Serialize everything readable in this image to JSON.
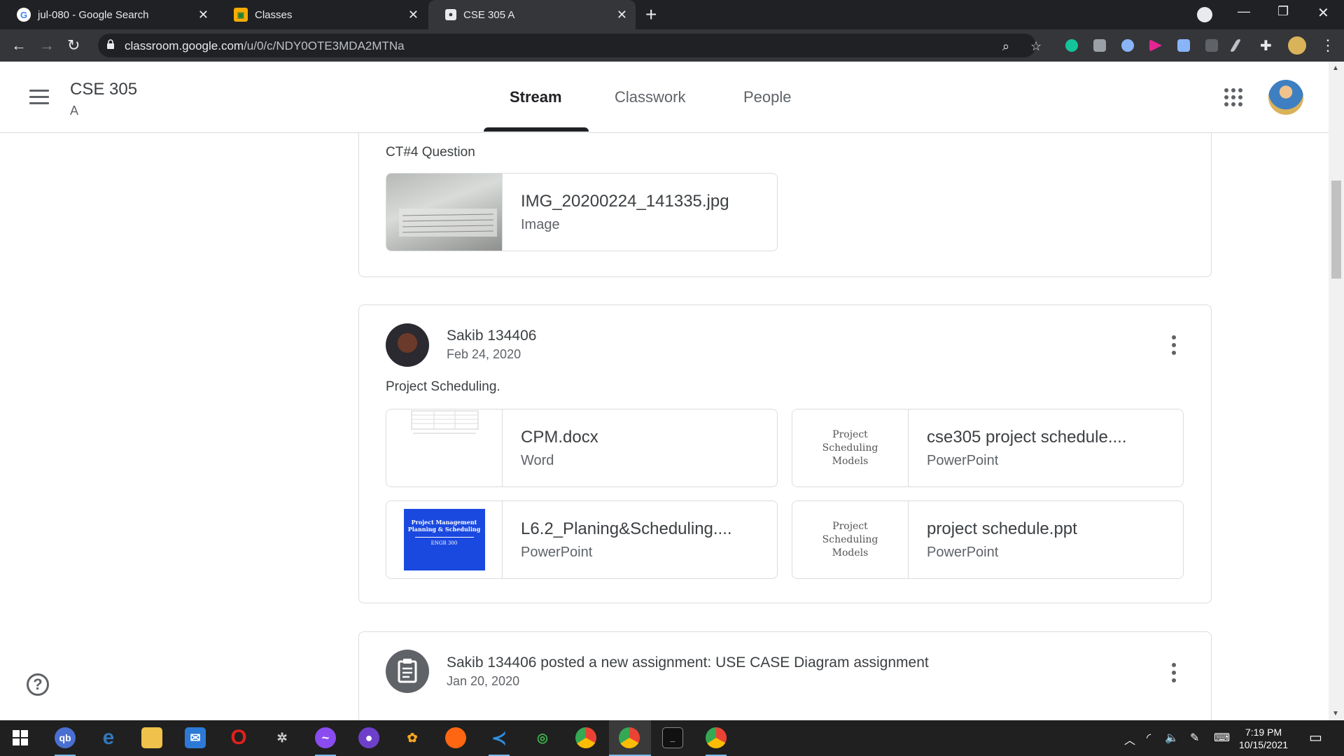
{
  "browser": {
    "tabs": [
      {
        "title": "jul-080 - Google Search",
        "favicon": "google-g-icon",
        "active": false
      },
      {
        "title": "Classes",
        "favicon": "classroom-icon",
        "active": false
      },
      {
        "title": "CSE 305 A",
        "favicon": "classroom-people-icon",
        "active": true
      }
    ],
    "url_host": "classroom.google.com",
    "url_path": "/u/0/c/NDY0OTE3MDA2MTNa"
  },
  "header": {
    "course_title": "CSE 305",
    "course_section": "A",
    "tabs": [
      {
        "label": "Stream",
        "active": true
      },
      {
        "label": "Classwork",
        "active": false
      },
      {
        "label": "People",
        "active": false
      }
    ]
  },
  "posts": [
    {
      "text": "CT#4 Question",
      "attachments": [
        {
          "name": "IMG_20200224_141335.jpg",
          "type": "Image"
        }
      ]
    },
    {
      "author": "Sakib 134406",
      "date": "Feb 24, 2020",
      "text": "Project Scheduling.",
      "attachments": [
        {
          "name": "CPM.docx",
          "type": "Word"
        },
        {
          "name": "cse305 project schedule....",
          "type": "PowerPoint",
          "thumb_text": "Project Scheduling Models"
        },
        {
          "name": "L6.2_Planing&Scheduling....",
          "type": "PowerPoint"
        },
        {
          "name": "project schedule.ppt",
          "type": "PowerPoint",
          "thumb_text": "Project Scheduling Models"
        }
      ]
    },
    {
      "title": "Sakib 134406 posted a new assignment: USE CASE Diagram assignment",
      "date": "Jan 20, 2020"
    }
  ],
  "thumbnails": {
    "l62_title": "Project Management Planning & Scheduling",
    "l62_course": "ENGR 300"
  },
  "taskbar": {
    "time": "7:19 PM",
    "date": "10/15/2021"
  },
  "colors": {
    "chrome_dark": "#202124",
    "chrome_tab": "#35363a",
    "border": "#dadce0",
    "text_primary": "#3c4043",
    "text_secondary": "#5f6368",
    "ppt_thumb_blue": "#1a49e0"
  }
}
